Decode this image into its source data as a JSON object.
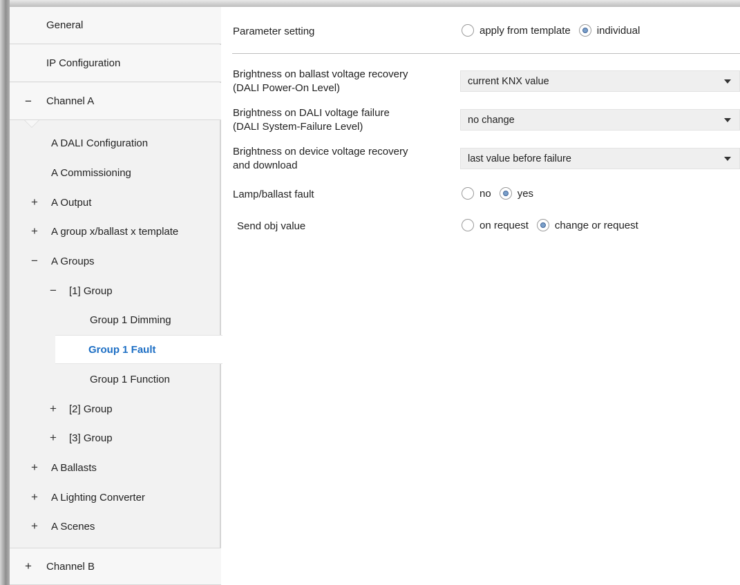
{
  "sidebar": {
    "general": "General",
    "ip_config": "IP Configuration",
    "channel_a": "Channel A",
    "channel_a_toggle": "−",
    "dali_config": "A DALI Configuration",
    "commissioning": "A Commissioning",
    "output": "A Output",
    "output_toggle": "+",
    "group_template": "A group x/ballast x template",
    "group_template_toggle": "+",
    "groups": "A Groups",
    "groups_toggle": "−",
    "group1": "[1] Group",
    "group1_toggle": "−",
    "group1_dimming": "Group 1 Dimming",
    "group1_fault": "Group 1 Fault",
    "group1_function": "Group 1 Function",
    "group2": "[2] Group",
    "group2_toggle": "+",
    "group3": "[3] Group",
    "group3_toggle": "+",
    "ballasts": "A Ballasts",
    "ballasts_toggle": "+",
    "lighting_converter": "A Lighting Converter",
    "lighting_converter_toggle": "+",
    "scenes": "A Scenes",
    "scenes_toggle": "+",
    "channel_b": "Channel B",
    "channel_b_toggle": "+"
  },
  "main": {
    "parameter_setting": {
      "label": "Parameter setting",
      "options": [
        "apply from template",
        "individual"
      ],
      "selected": "individual"
    },
    "power_on_level": {
      "label_line1": "Brightness on ballast voltage recovery",
      "label_line2": "(DALI Power-On Level)",
      "value": "current KNX value"
    },
    "system_failure_level": {
      "label_line1": "Brightness on DALI voltage failure",
      "label_line2": "(DALI System-Failure Level)",
      "value": "no change"
    },
    "device_recovery": {
      "label_line1": "Brightness on device voltage recovery",
      "label_line2": "and download",
      "value": "last value before failure"
    },
    "lamp_fault": {
      "label": "Lamp/ballast fault",
      "options": [
        "no",
        "yes"
      ],
      "selected": "yes"
    },
    "send_obj": {
      "label": "Send obj value",
      "options": [
        "on request",
        "change or request"
      ],
      "selected": "change or request"
    }
  },
  "colors": {
    "selected_text": "#1c6ec4",
    "sidebar_bg": "#f2f2f2",
    "radio_dot": "#7a9fc9"
  }
}
